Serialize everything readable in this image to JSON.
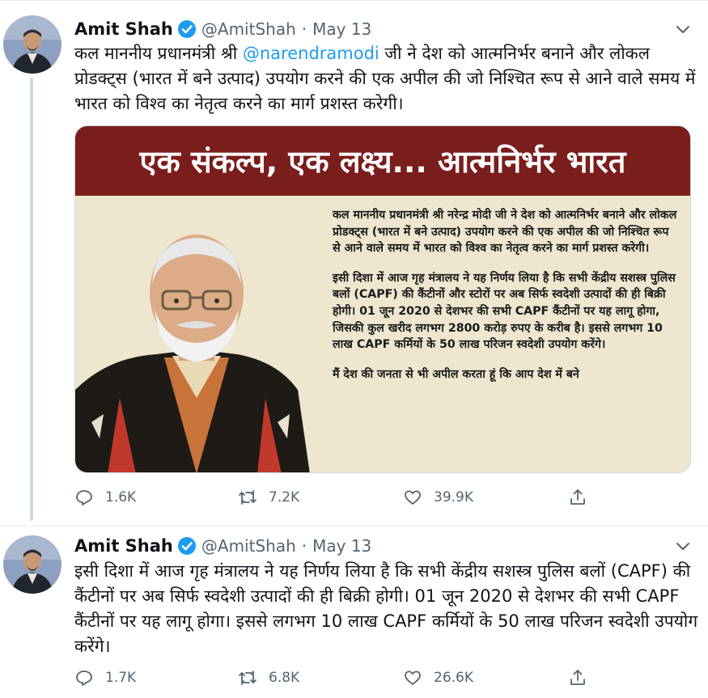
{
  "tweets": [
    {
      "author_name": "Amit Shah",
      "handle": "@AmitShah",
      "separator": "·",
      "date": "May 13",
      "text_before": "कल माननीय प्रधानमंत्री श्री ",
      "mention": "@narendramodi",
      "text_after": " जी ने देश को आत्मनिर्भर बनाने और लोकल प्रोडक्ट्स (भारत में बने उत्पाद) उपयोग करने की एक अपील की जो निश्चित रूप से आने वाले समय में भारत को विश्व का नेतृत्व करने का मार्ग प्रशस्त करेगी।",
      "media": {
        "banner": "एक संकल्प, एक लक्ष्य... आत्मनिर्भर भारत",
        "paragraphs": [
          "कल माननीय प्रधानमंत्री श्री नरेन्द्र मोदी जी ने देश को आत्मनिर्भर बनाने और लोकल प्रोडक्ट्स (भारत में बने उत्पाद) उपयोग करने की एक अपील की जो निश्चित रूप से आने वाले समय में भारत को विश्व का नेतृत्व करने का मार्ग प्रशस्त करेगी।",
          "इसी दिशा में आज गृह मंत्रालय ने यह निर्णय लिया है कि सभी केंद्रीय सशस्त्र पुलिस बलों (CAPF) की कैंटीनों और स्टोरों पर अब सिर्फ स्वदेशी उत्पादों की ही बिक्री होगी। 01 जून 2020 से देशभर की सभी CAPF कैंटीनों पर यह लागू होगा, जिसकी कुल खरीद लगभग 2800 करोड़ रुपए के करीब है। इससे लगभग 10 लाख CAPF कर्मियों के 50 लाख परिजन स्वदेशी उपयोग करेंगे।",
          "मैं देश की जनता से भी अपील करता हूं कि आप देश में बने"
        ]
      },
      "stats": {
        "replies": "1.6K",
        "retweets": "7.2K",
        "likes": "39.9K"
      }
    },
    {
      "author_name": "Amit Shah",
      "handle": "@AmitShah",
      "separator": "·",
      "date": "May 13",
      "text": "इसी दिशा में आज गृह मंत्रालय ने यह निर्णय लिया है कि सभी केंद्रीय सशस्त्र पुलिस बलों (CAPF) की कैंटीनों पर अब सिर्फ स्वदेशी उत्पादों की ही बिक्री होगी। 01 जून 2020 से देशभर की सभी CAPF कैंटीनों पर यह लागू होगा। इससे लगभग 10 लाख CAPF कर्मियों के 50 लाख परिजन स्वदेशी उपयोग करेंगे।",
      "stats": {
        "replies": "1.7K",
        "retweets": "6.8K",
        "likes": "26.6K"
      }
    }
  ],
  "colors": {
    "accent": "#1d9bf0",
    "text": "#0f1419",
    "secondary": "#536471",
    "banner": "#7a1d1d",
    "poster_bg": "#efe6cf"
  },
  "icons": [
    "verified-badge-icon",
    "caret-down-icon",
    "reply-icon",
    "retweet-icon",
    "like-icon",
    "share-icon"
  ]
}
